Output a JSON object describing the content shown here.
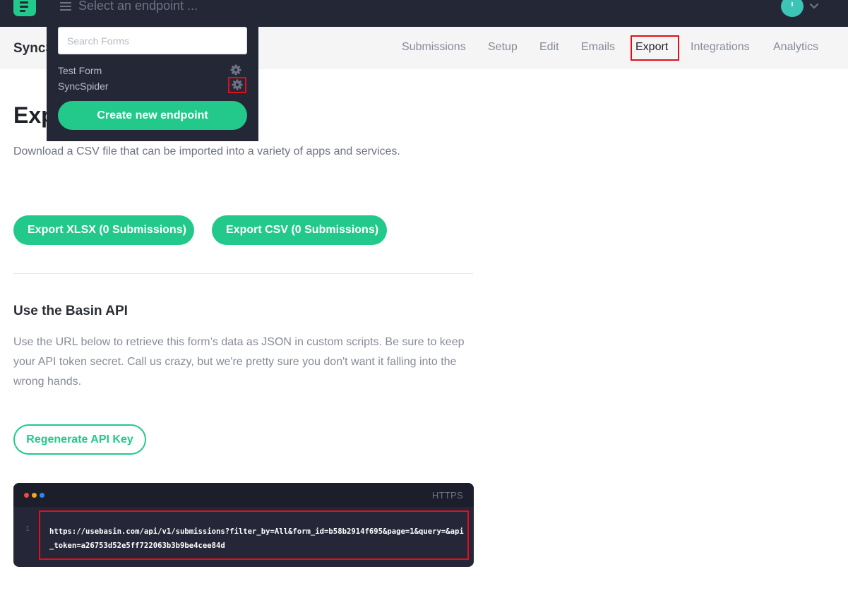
{
  "topbar": {
    "endpoint_select_label": "Select an endpoint ..."
  },
  "subnav": {
    "form_name": "SyncSpider",
    "tabs": [
      {
        "label": "Submissions"
      },
      {
        "label": "Setup"
      },
      {
        "label": "Edit"
      },
      {
        "label": "Emails"
      },
      {
        "label": "Export"
      },
      {
        "label": "Integrations"
      },
      {
        "label": "Analytics"
      }
    ],
    "active_tab": "Export"
  },
  "dropdown": {
    "search_placeholder": "Search Forms",
    "endpoints": [
      {
        "name": "Test Form"
      },
      {
        "name": "SyncSpider"
      }
    ],
    "create_label": "Create new endpoint"
  },
  "main": {
    "title": "Export",
    "description": "Download a CSV file that can be imported into a variety of apps and services.",
    "export_xlsx_label": "Export XLSX (0 Submissions)",
    "export_csv_label": "Export CSV (0 Submissions)",
    "api_heading": "Use the Basin API",
    "api_description": "Use the URL below to retrieve this form’s data as JSON in custom scripts. Be sure to keep your API token secret. Call us crazy, but we're pretty sure you don't want it falling into the wrong hands.",
    "regenerate_label": "Regenerate API Key",
    "code": {
      "language": "HTTPS",
      "line_number": "1",
      "url": "https://usebasin.com/api/v1/submissions?filter_by=All&form_id=b58b2914f695&page=1&query=&api_token=a26753d52e5ff722063b3b9be4cee84d"
    }
  },
  "icons": {
    "menu": "hamburger-icon",
    "settings": "gear-icon",
    "dropdown": "chevron-down-icon",
    "logo": "basin-logo-icon"
  },
  "colors": {
    "topbar": "#242736",
    "accent_green": "#22c98b",
    "highlight_red": "#e0101a",
    "avatar": "#3cc4b4",
    "code_bg": "#252738"
  }
}
